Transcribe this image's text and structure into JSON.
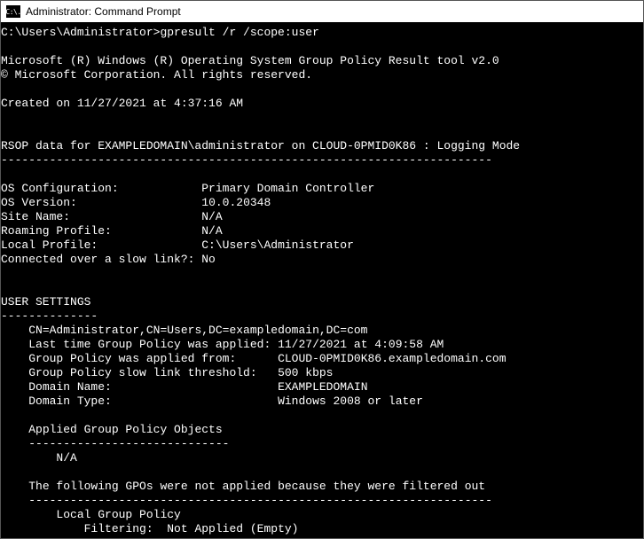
{
  "titlebar": {
    "icon_text": "C:\\.",
    "title": "Administrator: Command Prompt"
  },
  "prompt": {
    "path": "C:\\Users\\Administrator>",
    "command": "gpresult /r /scope:user"
  },
  "header": {
    "line1": "Microsoft (R) Windows (R) Operating System Group Policy Result tool v2.0",
    "line2": "© Microsoft Corporation. All rights reserved."
  },
  "created": {
    "label": "Created on ",
    "value": "‎11/‎27/‎2021 at 4:37:16 AM"
  },
  "rsop": {
    "text": "RSOP data for EXAMPLEDOMAIN\\administrator on CLOUD-0PMID0K86 : Logging Mode",
    "divider": "-----------------------------------------------------------------------"
  },
  "sysinfo": {
    "os_config_label": "OS Configuration:",
    "os_config_value": "Primary Domain Controller",
    "os_version_label": "OS Version:",
    "os_version_value": "10.0.20348",
    "site_label": "Site Name:",
    "site_value": "N/A",
    "roaming_label": "Roaming Profile:",
    "roaming_value": "N/A",
    "local_label": "Local Profile:",
    "local_value": "C:\\Users\\Administrator",
    "slowlink_label": "Connected over a slow link?:",
    "slowlink_value": "No"
  },
  "user_settings": {
    "heading": "USER SETTINGS",
    "divider": "--------------",
    "cn": "CN=Administrator,CN=Users,DC=exampledomain,DC=com",
    "last_applied_label": "Last time Group Policy was applied:",
    "last_applied_value": "11/27/2021 at 4:09:58 AM",
    "applied_from_label": "Group Policy was applied from:",
    "applied_from_value": "CLOUD-0PMID0K86.exampledomain.com",
    "slow_threshold_label": "Group Policy slow link threshold:",
    "slow_threshold_value": "500 kbps",
    "domain_name_label": "Domain Name:",
    "domain_name_value": "EXAMPLEDOMAIN",
    "domain_type_label": "Domain Type:",
    "domain_type_value": "Windows 2008 or later"
  },
  "applied_gpo": {
    "heading": "Applied Group Policy Objects",
    "divider": "-----------------------------",
    "value": "N/A"
  },
  "filtered": {
    "heading": "The following GPOs were not applied because they were filtered out",
    "divider": "-------------------------------------------------------------------",
    "item": "Local Group Policy",
    "filter_label": "Filtering:",
    "filter_value": "Not Applied (Empty)"
  }
}
